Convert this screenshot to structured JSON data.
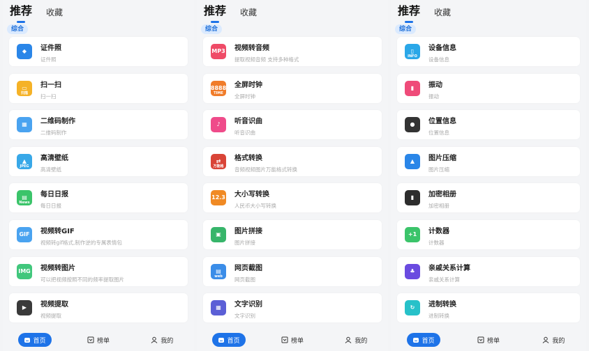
{
  "colors": {
    "accent": "#1e73e8",
    "page_bg": "#f4f5f7"
  },
  "panels": [
    {
      "tabs": {
        "active": "推荐",
        "other": "收藏"
      },
      "chip": "综合",
      "items": [
        {
          "title": "证件照",
          "subtitle": "证件照",
          "icon": "id-photo-icon",
          "color": "#2a86e8",
          "glyph": "◆",
          "sub": ""
        },
        {
          "title": "扫一扫",
          "subtitle": "扫一扫",
          "icon": "scan-icon",
          "color": "#f5b227",
          "glyph": "▭",
          "sub": "扫描"
        },
        {
          "title": "二维码制作",
          "subtitle": "二维码制作",
          "icon": "qrcode-icon",
          "color": "#4aa3f0",
          "glyph": "▦",
          "sub": ""
        },
        {
          "title": "高清壁纸",
          "subtitle": "高清壁纸",
          "icon": "wallpaper-icon",
          "color": "#38a8e8",
          "glyph": "▲",
          "sub": "JPEG"
        },
        {
          "title": "每日日报",
          "subtitle": "每日日报",
          "icon": "daily-news-icon",
          "color": "#3bc46a",
          "glyph": "▤",
          "sub": "News"
        },
        {
          "title": "视频转GIF",
          "subtitle": "视频转gif格式,制作逆的专属表情包",
          "icon": "gif-icon",
          "color": "#4aa3f0",
          "glyph": "GIF",
          "sub": ""
        },
        {
          "title": "视频转图片",
          "subtitle": "可以把视频按照不同的频率提取图片",
          "icon": "video-image-icon",
          "color": "#41c77c",
          "glyph": "IMG",
          "sub": ""
        },
        {
          "title": "视频提取",
          "subtitle": "视频提取",
          "icon": "video-extract-icon",
          "color": "#3a3a3a",
          "glyph": "▶",
          "sub": ""
        }
      ],
      "nav": {
        "home": "首页",
        "rank": "榜单",
        "mine": "我的"
      }
    },
    {
      "tabs": {
        "active": "推荐",
        "other": "收藏"
      },
      "chip": "综合",
      "items": [
        {
          "title": "视频转音频",
          "subtitle": "提取视频音频 支持多种格式",
          "icon": "video-audio-icon",
          "color": "#ef4b67",
          "glyph": "MP3",
          "sub": ""
        },
        {
          "title": "全屏时钟",
          "subtitle": "全屏时钟",
          "icon": "clock-icon",
          "color": "#f07c2a",
          "glyph": "8888",
          "sub": "TIME"
        },
        {
          "title": "听音识曲",
          "subtitle": "听音识曲",
          "icon": "music-icon",
          "color": "#ef4b8a",
          "glyph": "♪",
          "sub": ""
        },
        {
          "title": "格式转换",
          "subtitle": "音频视频图片万能格式转换",
          "icon": "format-convert-icon",
          "color": "#d94437",
          "glyph": "⇄",
          "sub": "万能格"
        },
        {
          "title": "大小写转换",
          "subtitle": "人民币大小写转换",
          "icon": "case-convert-icon",
          "color": "#f08a24",
          "glyph": "12.3",
          "sub": ""
        },
        {
          "title": "图片拼接",
          "subtitle": "图片拼接",
          "icon": "image-stitch-icon",
          "color": "#37b56a",
          "glyph": "▣",
          "sub": ""
        },
        {
          "title": "网页截图",
          "subtitle": "网页截图",
          "icon": "web-screenshot-icon",
          "color": "#3b8de8",
          "glyph": "▤",
          "sub": "web"
        },
        {
          "title": "文字识别",
          "subtitle": "文字识别",
          "icon": "ocr-icon",
          "color": "#5b5fd6",
          "glyph": "▦",
          "sub": ""
        }
      ],
      "nav": {
        "home": "首页",
        "rank": "榜单",
        "mine": "我的"
      }
    },
    {
      "tabs": {
        "active": "推荐",
        "other": "收藏"
      },
      "chip": "综合",
      "items": [
        {
          "title": "设备信息",
          "subtitle": "设备信息",
          "icon": "device-info-icon",
          "color": "#2aa7e8",
          "glyph": "▯",
          "sub": "INFO"
        },
        {
          "title": "振动",
          "subtitle": "振动",
          "icon": "vibrate-icon",
          "color": "#ef4b79",
          "glyph": "▮",
          "sub": ""
        },
        {
          "title": "位置信息",
          "subtitle": "位置信息",
          "icon": "location-icon",
          "color": "#333333",
          "glyph": "●",
          "sub": ""
        },
        {
          "title": "图片压缩",
          "subtitle": "图片压缩",
          "icon": "image-compress-icon",
          "color": "#2a86e8",
          "glyph": "▲",
          "sub": ""
        },
        {
          "title": "加密相册",
          "subtitle": "加密相册",
          "icon": "secure-album-icon",
          "color": "#2d2d2d",
          "glyph": "▮",
          "sub": ""
        },
        {
          "title": "计数器",
          "subtitle": "计数器",
          "icon": "counter-icon",
          "color": "#3bc46a",
          "glyph": "+1",
          "sub": ""
        },
        {
          "title": "亲戚关系计算",
          "subtitle": "亲戚关系计算",
          "icon": "relative-calc-icon",
          "color": "#6a4be0",
          "glyph": "♣",
          "sub": ""
        },
        {
          "title": "进制转换",
          "subtitle": "进制转换",
          "icon": "base-convert-icon",
          "color": "#27c1c9",
          "glyph": "↻",
          "sub": ""
        }
      ],
      "nav": {
        "home": "首页",
        "rank": "榜单",
        "mine": "我的"
      }
    }
  ]
}
